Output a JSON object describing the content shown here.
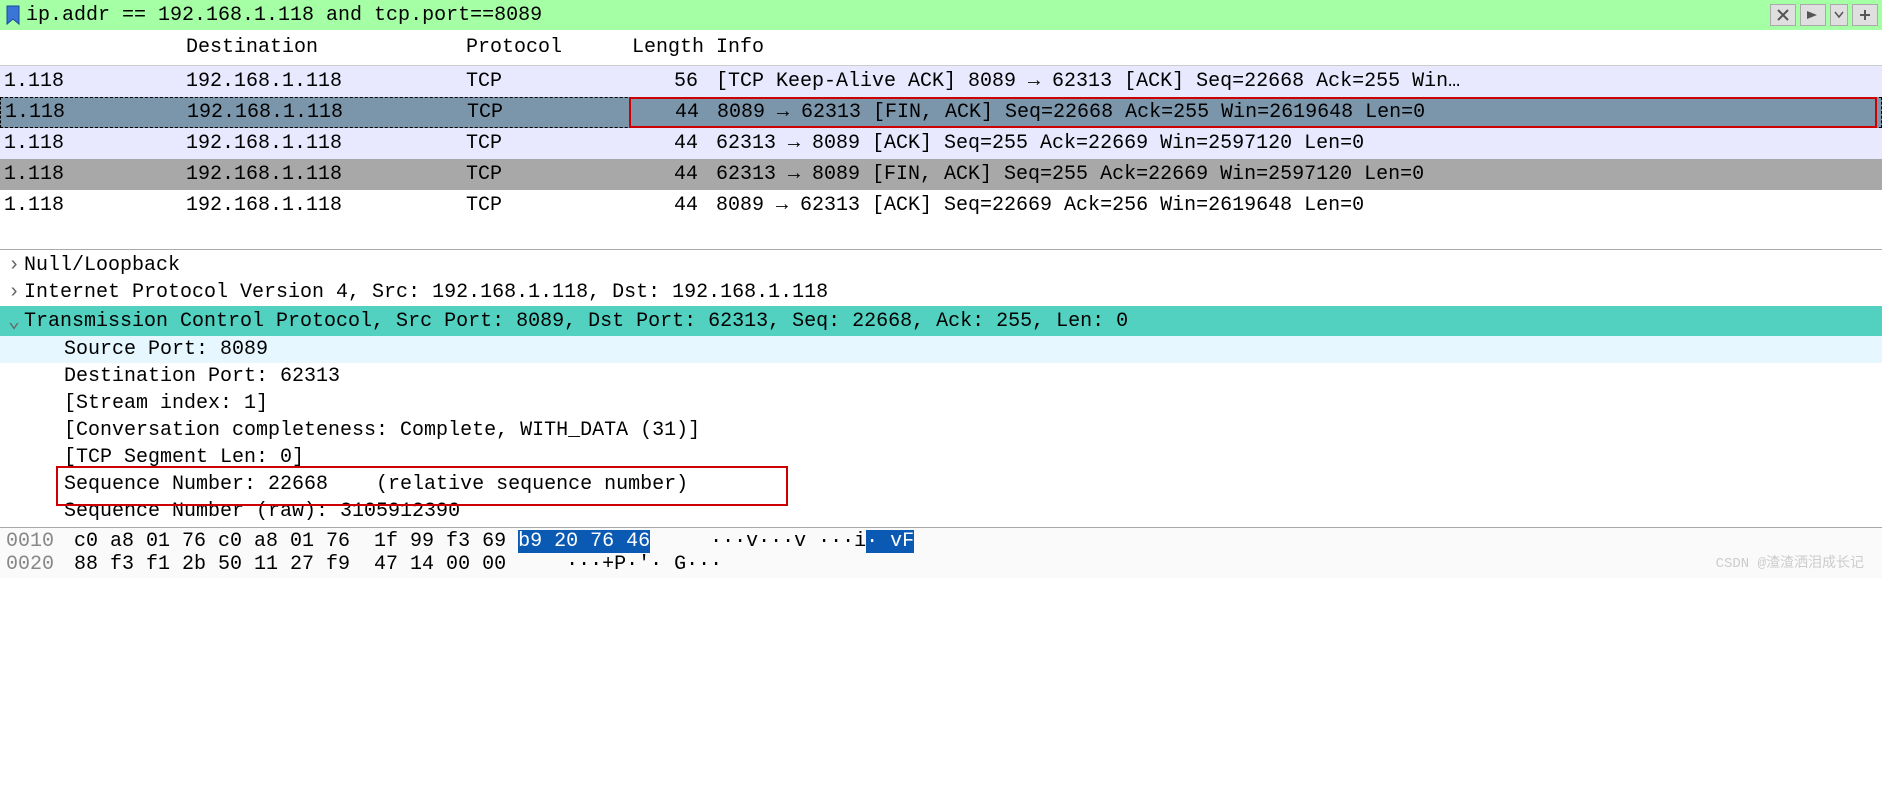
{
  "filter": {
    "expression": "ip.addr == 192.168.1.118 and tcp.port==8089"
  },
  "columns": {
    "destination": "Destination",
    "protocol": "Protocol",
    "length": "Length",
    "info": "Info"
  },
  "packets": [
    {
      "src": "1.118",
      "dst": "192.168.1.118",
      "proto": "TCP",
      "len": "56",
      "info": "[TCP Keep-Alive ACK] 8089 → 62313 [ACK] Seq=22668 Ack=255 Win…"
    },
    {
      "src": "1.118",
      "dst": "192.168.1.118",
      "proto": "TCP",
      "len": "44",
      "info": "8089 → 62313 [FIN, ACK] Seq=22668 Ack=255 Win=2619648 Len=0"
    },
    {
      "src": "1.118",
      "dst": "192.168.1.118",
      "proto": "TCP",
      "len": "44",
      "info": "62313 → 8089 [ACK] Seq=255 Ack=22669 Win=2597120 Len=0"
    },
    {
      "src": "1.118",
      "dst": "192.168.1.118",
      "proto": "TCP",
      "len": "44",
      "info": "62313 → 8089 [FIN, ACK] Seq=255 Ack=22669 Win=2597120 Len=0"
    },
    {
      "src": "1.118",
      "dst": "192.168.1.118",
      "proto": "TCP",
      "len": "44",
      "info": "8089 → 62313 [ACK] Seq=22669 Ack=256 Win=2619648 Len=0"
    }
  ],
  "details": {
    "null_loopback": "Null/Loopback",
    "ipv4": "Internet Protocol Version 4, Src: 192.168.1.118, Dst: 192.168.1.118",
    "tcp": "Transmission Control Protocol, Src Port: 8089, Dst Port: 62313, Seq: 22668, Ack: 255, Len: 0",
    "src_port": "Source Port: 8089",
    "dst_port": "Destination Port: 62313",
    "stream_index": "[Stream index: 1]",
    "conv_complete": "[Conversation completeness: Complete, WITH_DATA (31)]",
    "seg_len": "[TCP Segment Len: 0]",
    "seq_num": "Sequence Number: 22668    (relative sequence number)",
    "seq_raw": "Sequence Number (raw): 3105912390"
  },
  "hex": {
    "row1": {
      "offset": "0010",
      "bytes_a": "c0 a8 01 76 c0 a8 01 76  1f 99 f3 69 ",
      "bytes_hl": "b9 20 76 46",
      "ascii_a": "···v···v ···i",
      "ascii_hl": "· vF"
    },
    "row2": {
      "offset": "0020",
      "bytes": "88 f3 f1 2b 50 11 27 f9  47 14 00 00",
      "ascii": "···+P·'· G···"
    }
  },
  "watermark": "CSDN @渣渣洒泪成长记"
}
